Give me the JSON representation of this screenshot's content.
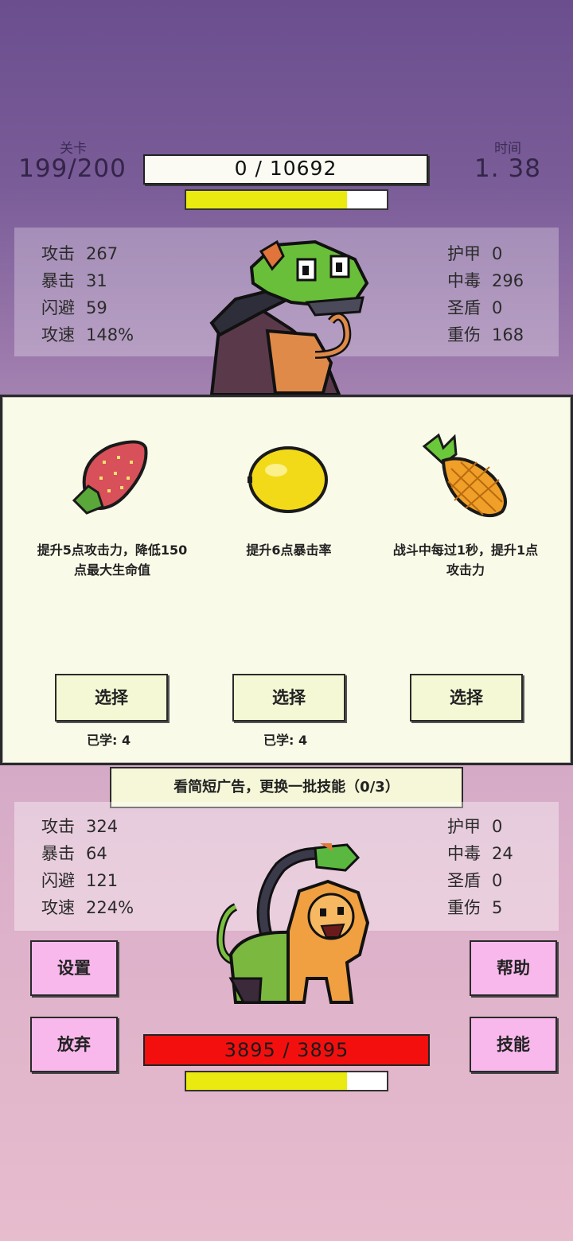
{
  "header": {
    "level_label": "关卡",
    "level_value": "199/200",
    "time_label": "时间",
    "time_value": "1. 38"
  },
  "enemy": {
    "hp_text": "0  /  10692",
    "energy_fill": 0.8,
    "stats_left": [
      {
        "label": "攻击",
        "value": "267"
      },
      {
        "label": "暴击",
        "value": "31"
      },
      {
        "label": "闪避",
        "value": "59"
      },
      {
        "label": "攻速",
        "value": "148%"
      }
    ],
    "stats_right": [
      {
        "label": "护甲",
        "value": "0"
      },
      {
        "label": "中毒",
        "value": "296"
      },
      {
        "label": "圣盾",
        "value": "0"
      },
      {
        "label": "重伤",
        "value": "168"
      }
    ]
  },
  "skills": [
    {
      "icon": "strawberry-icon",
      "desc": "提升5点攻击力，降低150点最大生命值",
      "button": "选择",
      "learned": "已学: 4"
    },
    {
      "icon": "lemon-icon",
      "desc": "提升6点暴击率",
      "button": "选择",
      "learned": "已学: 4"
    },
    {
      "icon": "pineapple-icon",
      "desc": "战斗中每过1秒，提升1点攻击力",
      "button": "选择",
      "learned": ""
    }
  ],
  "ad_banner": "看简短广告，更换一批技能（0/3）",
  "player": {
    "stats_left": [
      {
        "label": "攻击",
        "value": "324"
      },
      {
        "label": "暴击",
        "value": "64"
      },
      {
        "label": "闪避",
        "value": "121"
      },
      {
        "label": "攻速",
        "value": "224%"
      }
    ],
    "stats_right": [
      {
        "label": "护甲",
        "value": "0"
      },
      {
        "label": "中毒",
        "value": "24"
      },
      {
        "label": "圣盾",
        "value": "0"
      },
      {
        "label": "重伤",
        "value": "5"
      }
    ],
    "hp_text": "3895  /  3895",
    "energy_fill": 0.8
  },
  "buttons": {
    "settings": "设置",
    "help": "帮助",
    "give_up": "放弃",
    "skills": "技能"
  },
  "colors": {
    "hp_red": "#f40f0f",
    "energy_yellow": "#eaea10",
    "button_pink": "#f8b8ec"
  }
}
